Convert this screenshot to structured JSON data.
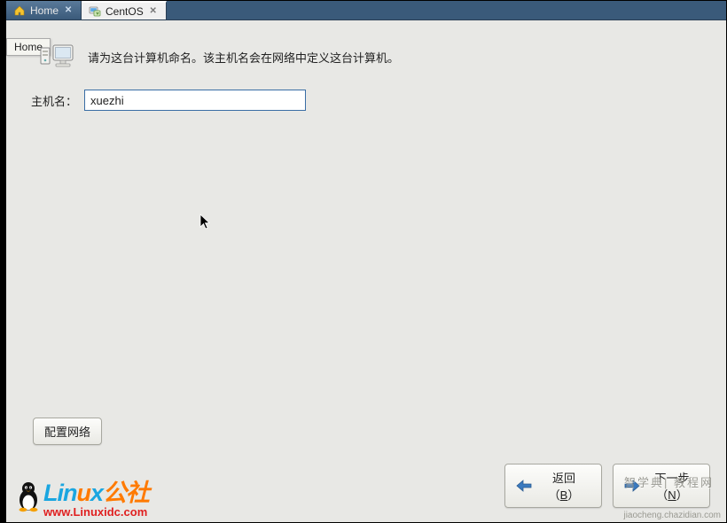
{
  "tabs": {
    "home": {
      "label": "Home"
    },
    "centos": {
      "label": "CentOS"
    }
  },
  "tooltip": {
    "home": "Home"
  },
  "installer": {
    "instruction": "请为这台计算机命名。该主机名会在网络中定义这台计算机。",
    "hostname_label": "主机名：",
    "hostname_value": "xuezhi",
    "config_network": "配置网络"
  },
  "nav": {
    "back_prefix": "返回（",
    "back_key": "B",
    "back_suffix": "）",
    "next_prefix": "下一步（",
    "next_key": "N",
    "next_suffix": "）"
  },
  "branding": {
    "logo_part1": "Lin",
    "logo_part2": "u",
    "logo_part3": "x",
    "logo_suffix": "公社",
    "url": "www.Linuxidc.com"
  },
  "watermark": {
    "line1": "智学典| 教程网",
    "line2": "jiaocheng.chazidian.com"
  }
}
